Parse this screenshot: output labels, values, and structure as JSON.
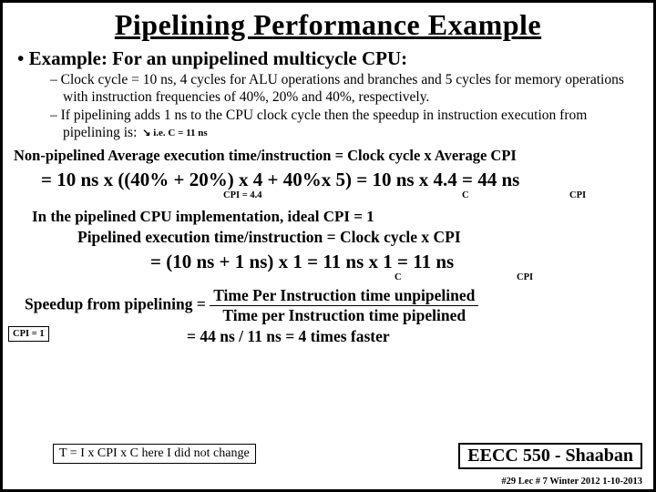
{
  "title": "Pipelining Performance Example",
  "lvl1": "Example:   For an unpipelined multicycle CPU:",
  "lvl2a": "Clock cycle = 10 ns, 4 cycles for ALU operations and branches and 5 cycles for memory operations with instruction frequencies of  40%, 20% and 40%, respectively.",
  "lvl2b": "If pipelining adds  1 ns to the CPU clock cycle then the speedup in instruction execution from pipelining is:",
  "arrow_note": "↘ i.e. C = 11 ns",
  "nonpipe_label": "Non-pipelined Average execution time/instruction =  Clock cycle  x Average CPI",
  "eq1_main": "= 10 ns x ((40% + 20%) x 4 + 40%x 5) =  10 ns    x 4.4 = 44 ns",
  "eq1_sub_cpi": "CPI = 4.4",
  "eq1_sub_c": "C",
  "eq1_sub_cpi2": "CPI",
  "ideal_line": "In the pipelined CPU implementation, ideal CPI = 1",
  "cpi_box": "CPI = 1",
  "pipe_line": "Pipelined execution time/instruction =  Clock cycle  x  CPI",
  "eq2_main": "= (10 ns + 1 ns) x 1  =    11 ns       x        1  = 11 ns",
  "eq2_sub_c": "C",
  "eq2_sub_cpi": "CPI",
  "speedup_lhs": "Speedup from pipelining   =",
  "frac_top": "Time Per Instruction time unpipelined",
  "frac_bot": "Time per Instruction time pipelined",
  "speedup2": "=  44 ns / 11 ns  = 4  times faster",
  "bottom_note": "T = I x CPI x C   here I did not change",
  "course": "EECC 550 - Shaaban",
  "footer": "#29   Lec # 7  Winter 2012  1-10-2013"
}
